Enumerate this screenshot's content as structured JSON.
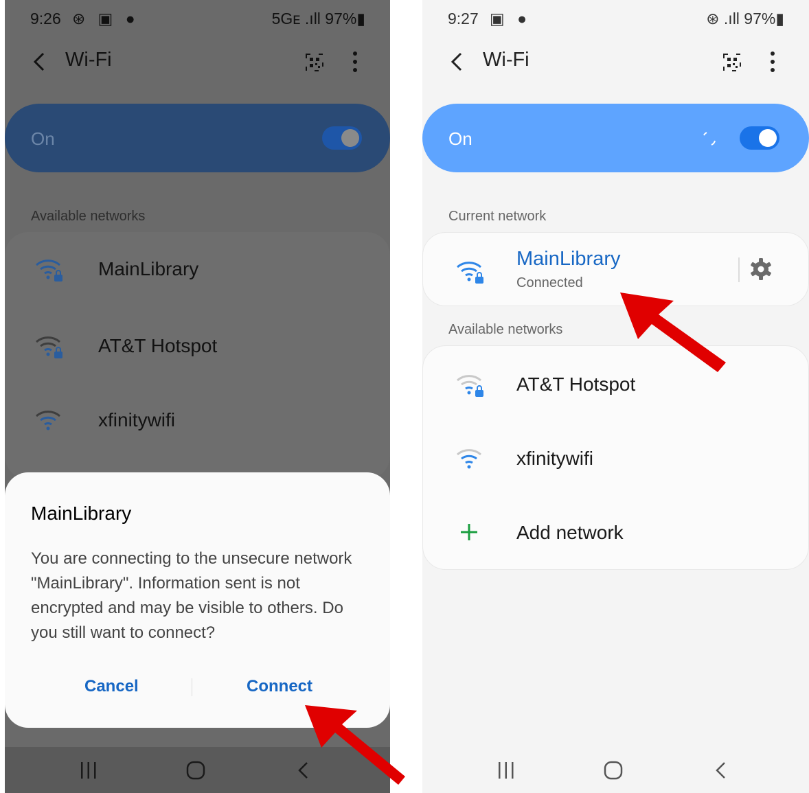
{
  "left_screen": {
    "status": {
      "time": "9:26",
      "icons": "⊛ ▣ ●",
      "right": "5Gᴇ .ıll 97%▮"
    },
    "appbar": {
      "title": "Wi-Fi"
    },
    "wifi_toggle": {
      "label": "On",
      "state": "on"
    },
    "available_label": "Available networks",
    "networks": [
      {
        "name": "MainLibrary",
        "secured": true
      },
      {
        "name": "AT&T Hotspot",
        "secured": true
      },
      {
        "name": "xfinitywifi",
        "secured": false
      }
    ],
    "dialog": {
      "title": "MainLibrary",
      "body": "You are connecting to the unsecure network \"MainLibrary\". Information sent is not encrypted and may be visible to others. Do you still want to connect?",
      "cancel": "Cancel",
      "connect": "Connect"
    }
  },
  "right_screen": {
    "status": {
      "time": "9:27",
      "icons": "▣ ●",
      "right": "⊛ .ıll 97%▮"
    },
    "appbar": {
      "title": "Wi-Fi"
    },
    "wifi_toggle": {
      "label": "On",
      "state": "on"
    },
    "current_label": "Current network",
    "current_network": {
      "name": "MainLibrary",
      "status": "Connected"
    },
    "available_label": "Available networks",
    "networks": [
      {
        "name": "AT&T Hotspot",
        "secured": true
      },
      {
        "name": "xfinitywifi",
        "secured": false
      }
    ],
    "add_network": "Add network"
  },
  "colors": {
    "accent_blue": "#1767c4",
    "toggle_blue": "#5ea4ff",
    "arrow_red": "#e00000",
    "plus_green": "#1a9e3f"
  },
  "icons": [
    "back-arrow-icon",
    "qr-code-icon",
    "more-vert-icon",
    "wifi-lock-icon",
    "wifi-icon",
    "gear-icon",
    "plus-icon",
    "recent-apps-icon",
    "home-icon",
    "nav-back-icon"
  ]
}
